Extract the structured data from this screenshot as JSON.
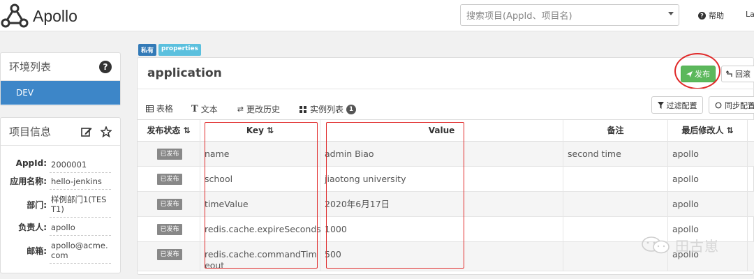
{
  "navbar": {
    "brand": "Apollo",
    "search_placeholder": "搜索项目(AppId、项目名)",
    "help_label": "帮助",
    "user_label": "La"
  },
  "env_panel": {
    "title": "环境列表",
    "items": [
      "DEV"
    ]
  },
  "info_panel": {
    "title": "项目信息",
    "fields": [
      {
        "key": "AppId:",
        "value": "2000001"
      },
      {
        "key": "应用名称:",
        "value": "hello-jenkins"
      },
      {
        "key": "部门:",
        "value": "样例部门1(TEST1)"
      },
      {
        "key": "负责人:",
        "value": "apollo"
      },
      {
        "key": "邮箱:",
        "value": "apollo@acme.com"
      }
    ]
  },
  "namespace": {
    "tags": [
      "私有",
      "properties"
    ],
    "title": "application",
    "publish_label": "发布",
    "rollback_label": "回滚",
    "tabs": [
      "表格",
      "文本",
      "更改历史",
      "实例列表"
    ],
    "instance_count": "1",
    "filter_label": "过滤配置",
    "sync_label": "同步配置"
  },
  "table": {
    "headers": {
      "status": "发布状态",
      "key": "Key",
      "value": "Value",
      "comment": "备注",
      "modifier": "最后修改人"
    },
    "rows": [
      {
        "status": "已发布",
        "key": "name",
        "value": "admin Biao",
        "comment": "second time",
        "modifier": "apollo"
      },
      {
        "status": "已发布",
        "key": "school",
        "value": "jiaotong university",
        "comment": "",
        "modifier": "apollo"
      },
      {
        "status": "已发布",
        "key": "timeValue",
        "value": "2020年6月17日",
        "comment": "",
        "modifier": "apollo"
      },
      {
        "status": "已发布",
        "key": "redis.cache.expireSeconds",
        "value": "1000",
        "comment": "",
        "modifier": "apollo"
      },
      {
        "status": "已发布",
        "key": "redis.cache.commandTimeout",
        "value": "500",
        "comment": "",
        "modifier": "apollo"
      }
    ]
  },
  "watermark": {
    "text": "田古崽"
  },
  "colors": {
    "primary": "#3d86c8",
    "success": "#5cb85c",
    "annotation_red": "#e02a2a"
  }
}
